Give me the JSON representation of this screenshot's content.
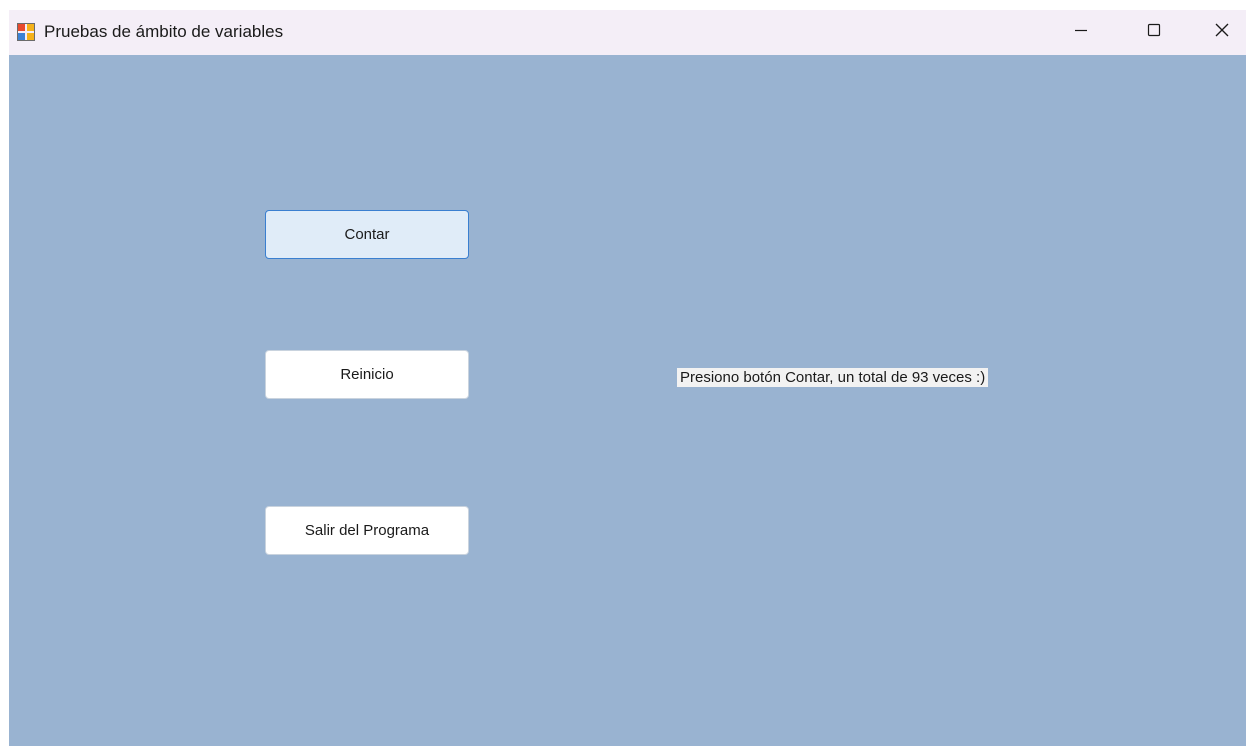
{
  "window": {
    "title": "Pruebas de ámbito de variables",
    "icon": "app-window-icon",
    "controls": {
      "minimize": "minimize-icon",
      "maximize": "maximize-icon",
      "close": "close-icon"
    }
  },
  "form": {
    "background_color": "#99b3d1",
    "buttons": {
      "contar": "Contar",
      "reinicio": "Reinicio",
      "salir": "Salir del Programa"
    },
    "status_label": "Presiono botón Contar, un total de 93 veces :)"
  }
}
